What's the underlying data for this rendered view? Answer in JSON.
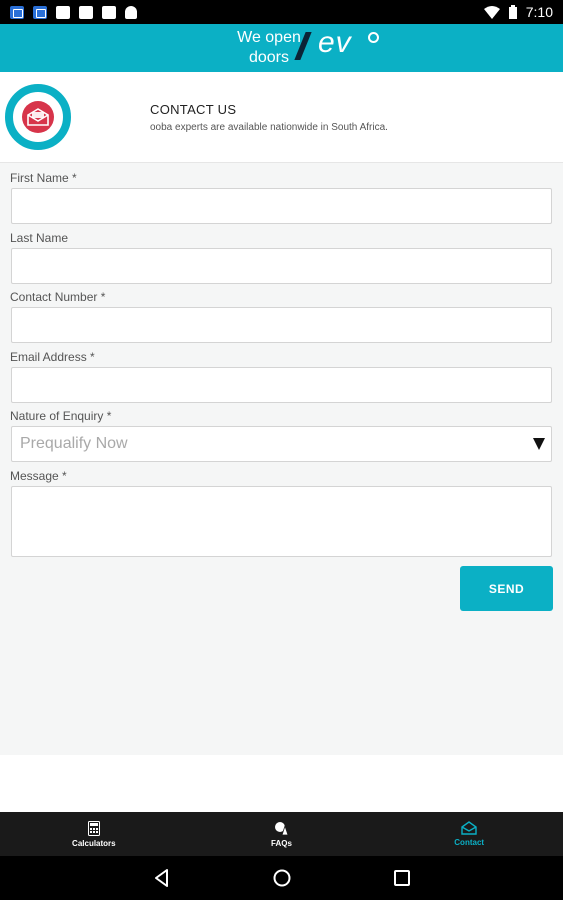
{
  "status_bar": {
    "time": "7:10"
  },
  "header": {
    "tagline_line1": "We open",
    "tagline_line2": "doors",
    "brand": "ev",
    "brand_color": "#0bb0c5"
  },
  "intro": {
    "title": "CONTACT US",
    "subtitle": "ooba experts are available nationwide in South Africa.",
    "icon": "envelope-icon"
  },
  "form": {
    "first_name_label": "First Name *",
    "first_name_value": "",
    "last_name_label": "Last Name",
    "last_name_value": "",
    "contact_number_label": "Contact Number *",
    "contact_number_value": "",
    "email_label": "Email Address *",
    "email_value": "",
    "enquiry_label": "Nature of Enquiry *",
    "enquiry_selected": "Prequalify Now",
    "message_label": "Message *",
    "message_value": "",
    "send_label": "SEND"
  },
  "tabs": [
    {
      "label": "Calculators",
      "icon": "calculator-icon",
      "active": false
    },
    {
      "label": "FAQs",
      "icon": "faq-icon",
      "active": false
    },
    {
      "label": "Contact",
      "icon": "contact-envelope-icon",
      "active": true
    }
  ],
  "colors": {
    "accent": "#0bb0c5",
    "icon_red": "#d7344a",
    "tab_bar": "#1a1a1a"
  }
}
